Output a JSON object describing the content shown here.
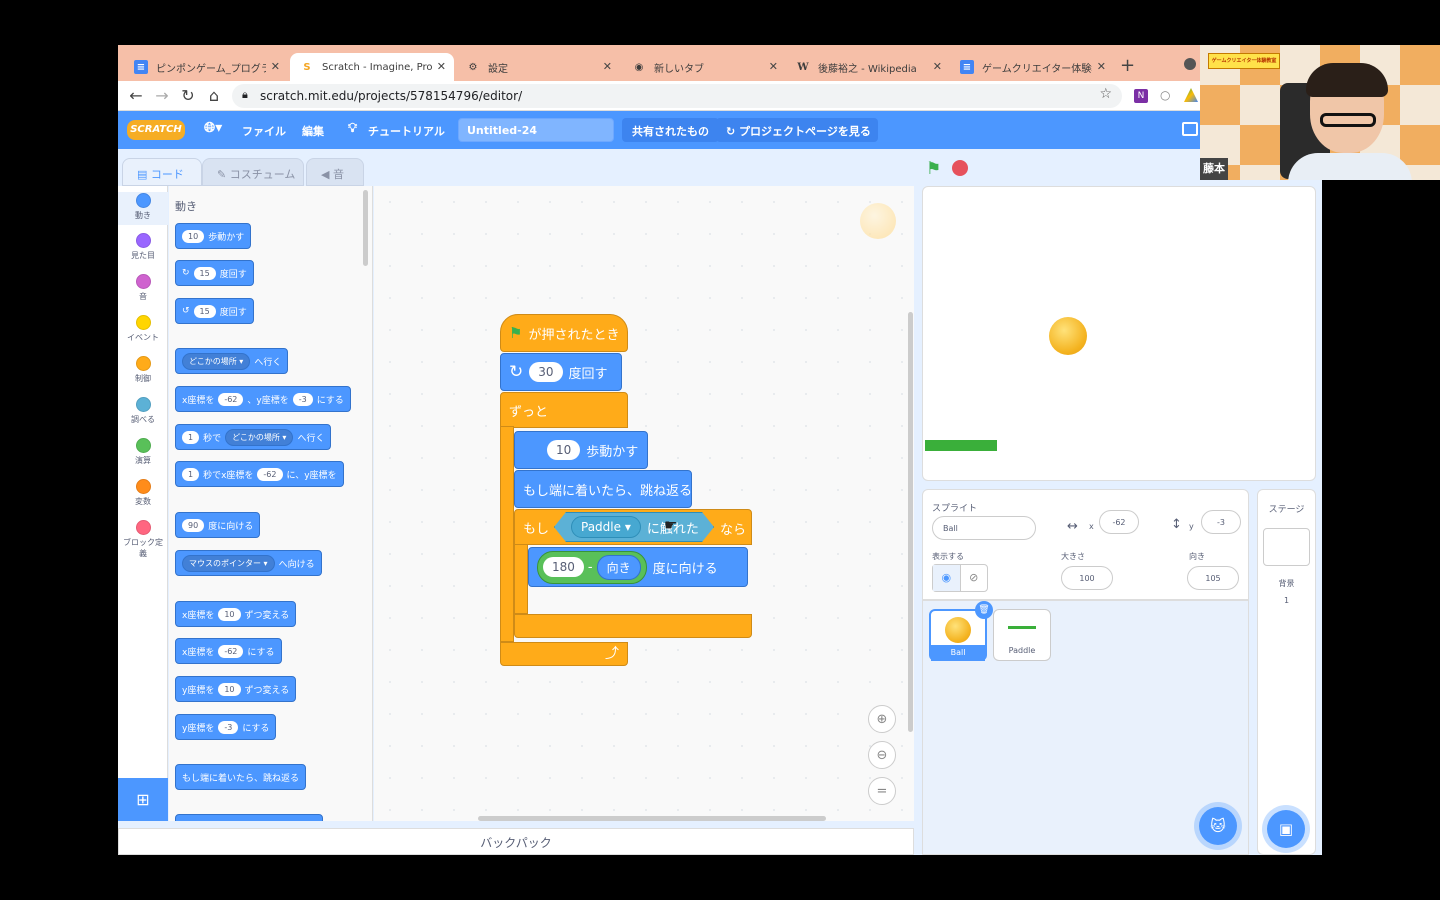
{
  "browser": {
    "tabs": [
      {
        "label": "ピンポンゲーム_プログラムメモ",
        "icon": "docs-icon"
      },
      {
        "label": "Scratch - Imagine, Progra",
        "icon": "scratch-icon"
      },
      {
        "label": "設定",
        "icon": "gear-icon"
      },
      {
        "label": "新しいタブ",
        "icon": "chrome-icon"
      },
      {
        "label": "後藤裕之 - Wikipedia",
        "icon": "wikipedia-icon"
      },
      {
        "label": "ゲームクリエイター体験教室",
        "icon": "docs-icon"
      }
    ],
    "url": "scratch.mit.edu/projects/578154796/editor/"
  },
  "menu": {
    "logo": "SCRATCH",
    "file": "ファイル",
    "edit": "編集",
    "tutorial": "チュートリアル",
    "title": "Untitled-24",
    "shared": "共有されたもの",
    "project_page": "プロジェクトページを見る"
  },
  "tabs": {
    "code": "コード",
    "costume": "コスチューム",
    "sound": "音"
  },
  "categories": [
    {
      "label": "動き",
      "color": "#4c97ff"
    },
    {
      "label": "見た目",
      "color": "#9966ff"
    },
    {
      "label": "音",
      "color": "#cf63cf"
    },
    {
      "label": "イベント",
      "color": "#ffd500"
    },
    {
      "label": "制御",
      "color": "#ffab19"
    },
    {
      "label": "調べる",
      "color": "#5cb1d6"
    },
    {
      "label": "演算",
      "color": "#59c059"
    },
    {
      "label": "変数",
      "color": "#ff8c1a"
    },
    {
      "label": "ブロック定義",
      "color": "#ff6680"
    }
  ],
  "palette": {
    "heading": "動き",
    "move_steps": "10",
    "move_label": "歩動かす",
    "turn_right": "15",
    "turn_left": "15",
    "turn_label": "度回す",
    "goto_dd": "どこかの場所",
    "goto_label": "へ行く",
    "goxy_x_label": "x座標を",
    "goxy_x": "-62",
    "goxy_y_label": "、y座標を",
    "goxy_y": "-3",
    "goxy_end": "にする",
    "glide_secs": "1",
    "glide_label": "秒で",
    "glide_dd": "どこかの場所",
    "glide_end": "へ行く",
    "glidexy_secs": "1",
    "glidexy_label": "秒でx座標を",
    "glidexy_x": "-62",
    "glidexy_mid": "に、y座標を",
    "point_dir": "90",
    "point_label": "度に向ける",
    "point_towards_dd": "マウスのポインター",
    "point_towards_label": "へ向ける",
    "changex_label": "x座標を",
    "changex": "10",
    "changex_end": "ずつ変える",
    "setx_label": "x座標を",
    "setx": "-62",
    "setx_end": "にする",
    "changey_label": "y座標を",
    "changey": "10",
    "changey_end": "ずつ変える",
    "sety_label": "y座標を",
    "sety": "-3",
    "sety_end": "にする",
    "bounce": "もし端に着いたら、跳ね返る"
  },
  "script": {
    "hat": "が押されたとき",
    "turn_val": "30",
    "turn_label": "度回す",
    "forever": "ずっと",
    "move_val": "10",
    "move_label": "歩動かす",
    "bounce": "もし端に着いたら、跳ね返る",
    "if_label": "もし",
    "touching_dd": "Paddle",
    "touching_label": "に触れた",
    "then_label": "なら",
    "point_val": "180",
    "minus": "-",
    "direction": "向き",
    "point_label": "度に向ける"
  },
  "backpack": "バックパック",
  "sprite_info": {
    "sprite_label": "スプライト",
    "sprite_name": "Ball",
    "x_label": "x",
    "x": "-62",
    "y_label": "y",
    "y": "-3",
    "show_label": "表示する",
    "size_label": "大きさ",
    "size": "100",
    "direction_label": "向き",
    "direction": "105"
  },
  "sprites": [
    {
      "name": "Ball"
    },
    {
      "name": "Paddle"
    }
  ],
  "stage_pane": {
    "title": "ステージ",
    "backdrops_label": "背景",
    "backdrops": "1"
  },
  "webcam": {
    "name": "藤本",
    "brand": "ゲームクリエイター体験教室"
  }
}
